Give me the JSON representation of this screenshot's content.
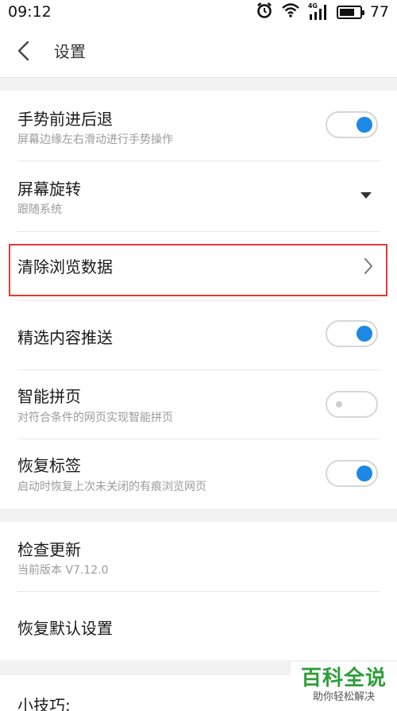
{
  "status": {
    "time": "09:12",
    "network": "4G",
    "battery": "77",
    "battery_level": 0.77
  },
  "header": {
    "title": "设置"
  },
  "settings": {
    "gesture": {
      "title": "手势前进后退",
      "subtitle": "屏幕边缘左右滑动进行手势操作",
      "enabled": true
    },
    "rotation": {
      "title": "屏幕旋转",
      "subtitle": "跟随系统"
    },
    "clear_data": {
      "title": "清除浏览数据"
    },
    "content_push": {
      "title": "精选内容推送",
      "enabled": true
    },
    "smart_page": {
      "title": "智能拼页",
      "subtitle": "对符合条件的网页实现智能拼页",
      "enabled": false
    },
    "restore_tabs": {
      "title": "恢复标签",
      "subtitle": "启动时恢复上次未关闭的有痕浏览网页",
      "enabled": true
    }
  },
  "about": {
    "check_update": {
      "title": "检查更新",
      "subtitle": "当前版本 V7.12.0"
    },
    "reset": {
      "title": "恢复默认设置"
    }
  },
  "tips": {
    "title": "小技巧:"
  },
  "watermark": {
    "main": "百科全说",
    "sub": "助你轻松解决"
  },
  "colors": {
    "accent": "#1e88e5",
    "highlight": "#e53935",
    "watermark": "#2e9e3a"
  }
}
